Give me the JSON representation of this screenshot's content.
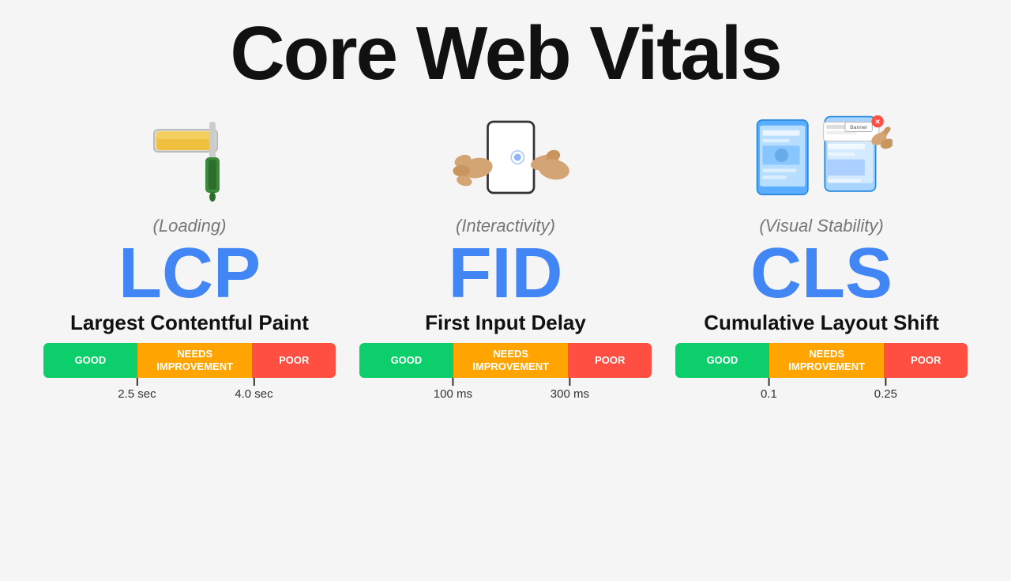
{
  "page": {
    "title": "Core Web Vitals",
    "bg_color": "#f5f5f5"
  },
  "vitals": [
    {
      "id": "lcp",
      "icon_label": "paint-roller",
      "icon_emoji": "🖌️",
      "category": "(Loading)",
      "acronym": "LCP",
      "name": "Largest Contentful Paint",
      "bar": {
        "good_label": "GOOD",
        "needs_label": "NEEDS\nIMPROVEMENT",
        "poor_label": "POOR",
        "good_pct": 32,
        "needs_pct": 40,
        "poor_pct": 28
      },
      "thresholds": [
        {
          "value": "2.5 sec",
          "pct": 32
        },
        {
          "value": "4.0 sec",
          "pct": 72
        }
      ]
    },
    {
      "id": "fid",
      "icon_label": "hand-touching-phone",
      "icon_emoji": "👆📱",
      "category": "(Interactivity)",
      "acronym": "FID",
      "name": "First Input Delay",
      "bar": {
        "good_label": "GOOD",
        "needs_label": "NEEDS\nIMPROVEMENT",
        "poor_label": "POOR",
        "good_pct": 32,
        "needs_pct": 40,
        "poor_pct": 28
      },
      "thresholds": [
        {
          "value": "100 ms",
          "pct": 32
        },
        {
          "value": "300 ms",
          "pct": 72
        }
      ]
    },
    {
      "id": "cls",
      "icon_label": "shifting-layout",
      "icon_emoji": "📱🔀",
      "category": "(Visual Stability)",
      "acronym": "CLS",
      "name": "Cumulative Layout Shift",
      "bar": {
        "good_label": "GOOD",
        "needs_label": "NEEDS\nIMPROVEMENT",
        "poor_label": "POOR",
        "good_pct": 32,
        "needs_pct": 40,
        "poor_pct": 28
      },
      "thresholds": [
        {
          "value": "0.1",
          "pct": 32
        },
        {
          "value": "0.25",
          "pct": 72
        }
      ]
    }
  ]
}
